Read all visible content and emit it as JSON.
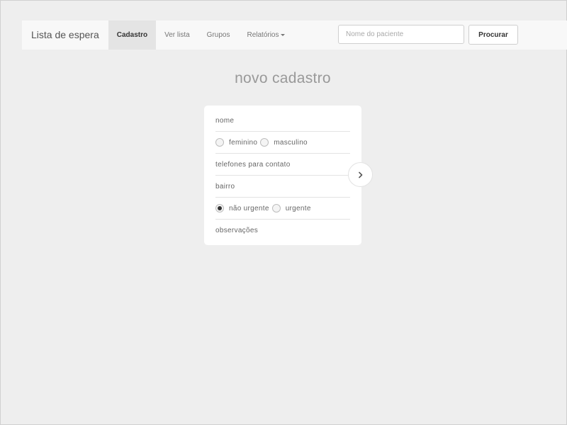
{
  "navbar": {
    "brand": "Lista de espera",
    "items": [
      {
        "label": "Cadastro",
        "active": true
      },
      {
        "label": "Ver lista",
        "active": false
      },
      {
        "label": "Grupos",
        "active": false
      },
      {
        "label": "Relatórios",
        "active": false,
        "dropdown": true
      }
    ],
    "search_placeholder": "Nome do paciente",
    "search_value": "",
    "search_button": "Procurar"
  },
  "page_title": "novo cadastro",
  "form": {
    "name_placeholder": "nome",
    "gender": {
      "options": [
        "feminino",
        "masculino"
      ],
      "selected": null
    },
    "phones_placeholder": "telefones para contato",
    "neighborhood_placeholder": "bairro",
    "urgency": {
      "options": [
        "não urgente",
        "urgente"
      ],
      "selected": "não urgente"
    },
    "notes_placeholder": "observações"
  },
  "next_icon": "chevron-right-icon",
  "colors": {
    "background": "#eeeeee",
    "navbar": "#f8f8f8",
    "active_tab": "#e4e4e4",
    "card": "#ffffff"
  }
}
